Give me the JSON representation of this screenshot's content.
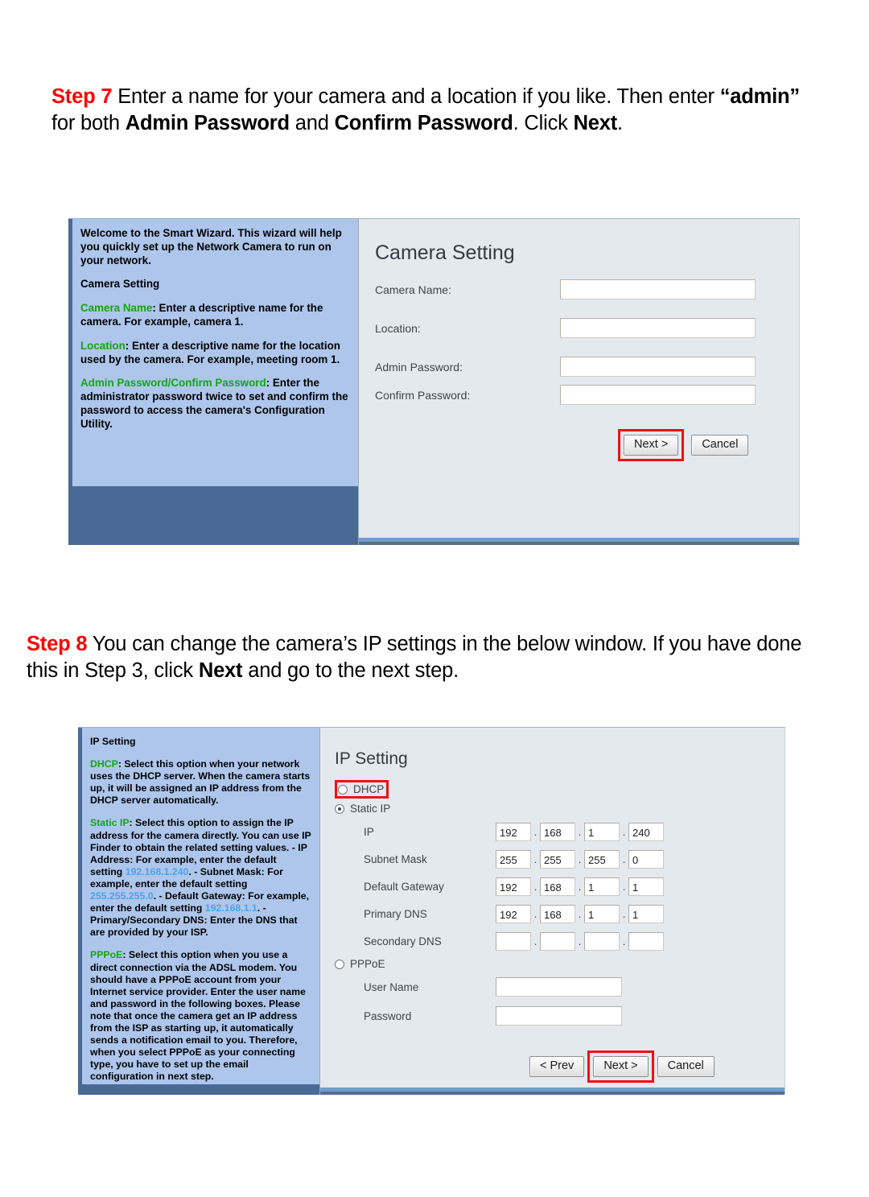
{
  "steps": [
    {
      "id": "step7",
      "label": "Step 7",
      "text_parts": [
        {
          "t": " Enter a name for your camera and a location if you like.  Then enter ",
          "bold": false
        },
        {
          "t": "“admin”",
          "bold": true
        },
        {
          "t": " for both ",
          "bold": false
        },
        {
          "t": "Admin Password",
          "bold": true
        },
        {
          "t": " and ",
          "bold": false
        },
        {
          "t": "Confirm Password",
          "bold": true
        },
        {
          "t": ".  Click ",
          "bold": false
        },
        {
          "t": "Next",
          "bold": true
        },
        {
          "t": ".",
          "bold": false
        }
      ]
    },
    {
      "id": "step8",
      "label": "Step 8",
      "text_parts": [
        {
          "t": " You can change the camera’s IP settings in the below window. If you have done this in Step 3, click ",
          "bold": false
        },
        {
          "t": "Next",
          "bold": true
        },
        {
          "t": " and go to the next step.",
          "bold": false
        }
      ]
    }
  ],
  "camera_wizard": {
    "help": {
      "paragraphs": [
        [
          {
            "t": "Welcome to the Smart Wizard. This wizard will help you quickly set up the Network Camera to run on your network.",
            "style": "plain"
          }
        ],
        [
          {
            "t": "Camera Setting",
            "style": "plain"
          }
        ],
        [
          {
            "t": "Camera Name",
            "style": "kw"
          },
          {
            "t": ": Enter a descriptive name for the camera. For example, camera 1.",
            "style": "plain"
          }
        ],
        [
          {
            "t": "Location",
            "style": "kw"
          },
          {
            "t": ": Enter a descriptive name for the location used by the camera. For example, meeting room 1.",
            "style": "plain"
          }
        ],
        [
          {
            "t": "Admin Password/Confirm Password",
            "style": "kw"
          },
          {
            "t": ": Enter the administrator password twice to set and confirm the password to access the camera's Configuration Utility.",
            "style": "plain"
          }
        ]
      ]
    },
    "title": "Camera Setting",
    "fields": [
      {
        "label": "Camera Name:",
        "value": ""
      },
      {
        "label": "Location:",
        "value": ""
      },
      {
        "label": "Admin Password:",
        "value": ""
      },
      {
        "label": "Confirm Password:",
        "value": ""
      }
    ],
    "buttons": {
      "next": "Next >",
      "cancel": "Cancel"
    },
    "highlight_color": "#ee1111"
  },
  "ip_wizard": {
    "help": {
      "paragraphs": [
        [
          {
            "t": "IP Setting",
            "style": "plain"
          }
        ],
        [
          {
            "t": "DHCP",
            "style": "kw"
          },
          {
            "t": ": Select this option when your network uses the DHCP server. When the camera starts up, it will be assigned an IP address from the DHCP server automatically.",
            "style": "plain"
          }
        ],
        [
          {
            "t": "Static IP",
            "style": "kw"
          },
          {
            "t": ": Select this option to assign the IP address for the camera directly. You can use IP Finder to obtain the related setting values.",
            "style": "plain"
          },
          {
            "t": " - IP Address: For example, enter the default setting ",
            "style": "plain"
          },
          {
            "t": "192.168.1.240",
            "style": "ipv"
          },
          {
            "t": ".",
            "style": "plain"
          },
          {
            "t": " - Subnet Mask: For example, enter the default setting ",
            "style": "plain"
          },
          {
            "t": "255.255.255.0",
            "style": "ipv"
          },
          {
            "t": ".",
            "style": "plain"
          },
          {
            "t": " - Default Gateway: For example, enter the default setting ",
            "style": "plain"
          },
          {
            "t": "192.168.1.1",
            "style": "ipv"
          },
          {
            "t": ".",
            "style": "plain"
          },
          {
            "t": " - Primary/Secondary DNS: Enter the DNS that are provided by your ISP.",
            "style": "plain"
          }
        ],
        [
          {
            "t": "PPPoE",
            "style": "kw"
          },
          {
            "t": ": Select this option when you use a direct connection via the ADSL modem. You should have a PPPoE account from your Internet service provider. Enter the user name and password in the following boxes. Please note that once the camera get an IP address from the ISP as starting up, it automatically sends a notification email to you. Therefore, when you select PPPoE as your connecting type, you have to set up the email configuration in next step.",
            "style": "plain"
          }
        ]
      ]
    },
    "title": "IP Setting",
    "options": {
      "dhcp": {
        "label": "DHCP",
        "checked": false,
        "highlighted": true
      },
      "static_ip": {
        "label": "Static IP",
        "checked": true,
        "highlighted": false
      },
      "pppoe": {
        "label": "PPPoE",
        "checked": false,
        "highlighted": false
      }
    },
    "ip_rows": [
      {
        "label": "IP",
        "octets": [
          "192",
          "168",
          "1",
          "240"
        ]
      },
      {
        "label": "Subnet Mask",
        "octets": [
          "255",
          "255",
          "255",
          "0"
        ]
      },
      {
        "label": "Default Gateway",
        "octets": [
          "192",
          "168",
          "1",
          "1"
        ]
      },
      {
        "label": "Primary DNS",
        "octets": [
          "192",
          "168",
          "1",
          "1"
        ]
      },
      {
        "label": "Secondary DNS",
        "octets": [
          "",
          "",
          "",
          ""
        ]
      }
    ],
    "pppoe_fields": [
      {
        "label": "User Name",
        "value": ""
      },
      {
        "label": "Password",
        "value": ""
      }
    ],
    "buttons": {
      "prev": "< Prev",
      "next": "Next >",
      "cancel": "Cancel"
    },
    "highlight_color": "#ee1111"
  }
}
